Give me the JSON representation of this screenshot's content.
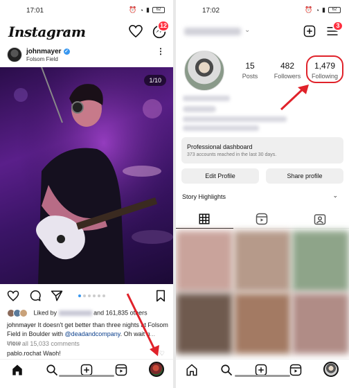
{
  "left": {
    "status": {
      "time": "17:01",
      "battery": "62"
    },
    "header": {
      "logo": "Instagram",
      "notif_badge": "12"
    },
    "post": {
      "username": "johnmayer",
      "location": "Folsom Field",
      "media_counter": "1/10",
      "liked_by_prefix": "Liked by",
      "liked_by_suffix": "and 161,835 others",
      "caption_user": "johnmayer",
      "caption_text": " It doesn't get better than three nights at Folsom Field in Boulder with ",
      "caption_tag": "@deadandcompany",
      "caption_end": ". Oh wait n",
      "caption_more": "... more",
      "view_comments": "View all 15,033 comments",
      "comment_user": "pablo.rochat",
      "comment_text": "Waoh!"
    }
  },
  "right": {
    "status": {
      "time": "17:02",
      "battery": "62"
    },
    "header": {
      "badge": "3"
    },
    "stats": [
      {
        "num": "15",
        "label": "Posts"
      },
      {
        "num": "482",
        "label": "Followers"
      },
      {
        "num": "1,479",
        "label": "Following"
      }
    ],
    "dashboard": {
      "title": "Professional dashboard",
      "subtitle": "373 accounts reached in the last 30 days."
    },
    "buttons": {
      "edit": "Edit Profile",
      "share": "Share profile"
    },
    "highlights": {
      "label": "Story Highlights"
    }
  },
  "colors": {
    "accent": "#3897f0",
    "badge": "#ff3040",
    "annotation": "#e0222a"
  }
}
